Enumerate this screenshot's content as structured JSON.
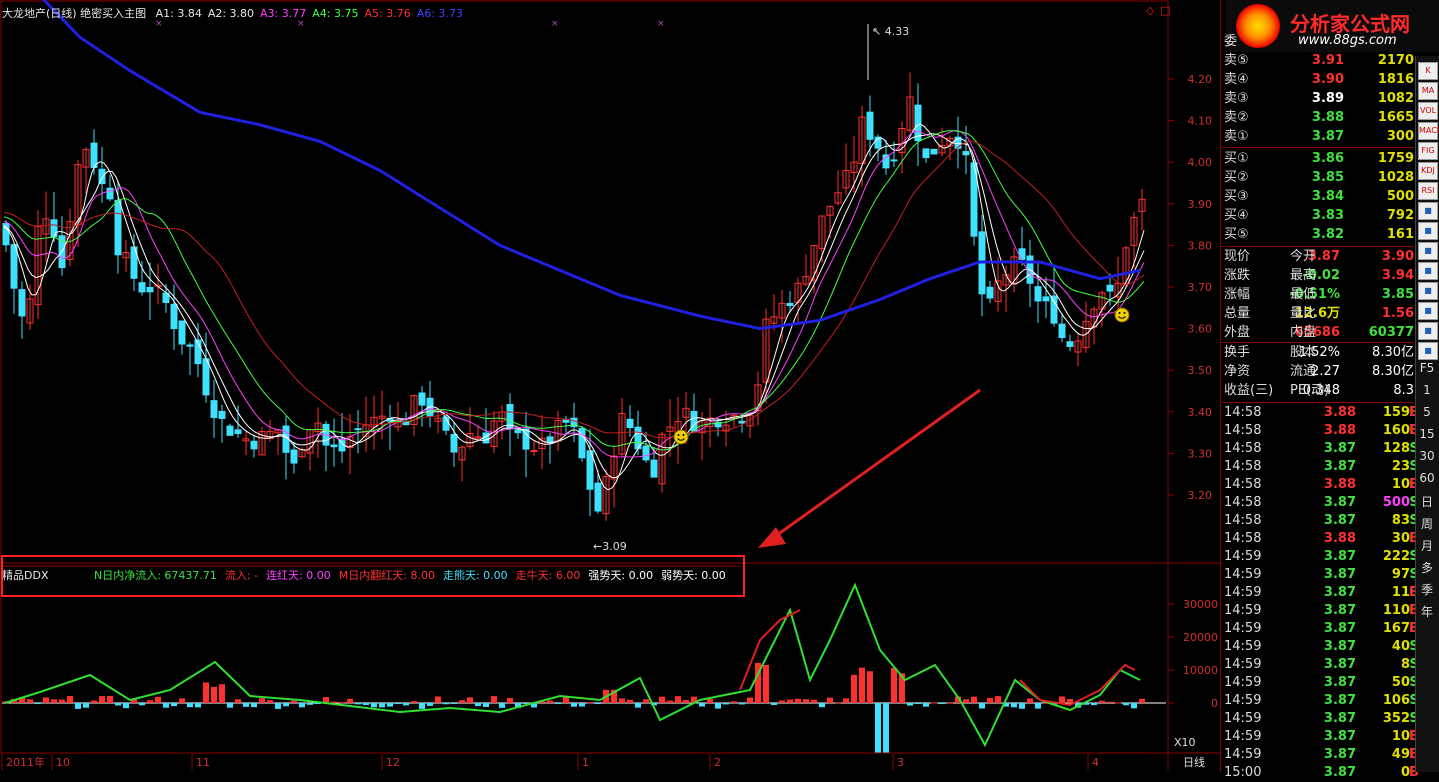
{
  "main_header": {
    "title": "大龙地产(日线) 绝密买入主图",
    "items": [
      {
        "label": "A1: 3.84",
        "color": "#e6e6e6"
      },
      {
        "label": "A2: 3.80",
        "color": "#e6e6e6"
      },
      {
        "label": "A3: 3.77",
        "color": "#ff40ff"
      },
      {
        "label": "A4: 3.75",
        "color": "#40ff40"
      },
      {
        "label": "A5: 3.76",
        "color": "#ff3030"
      },
      {
        "label": "A6: 3.73",
        "color": "#4040ff"
      }
    ]
  },
  "price_axis": [
    "4.20",
    "4.10",
    "4.00",
    "3.90",
    "3.80",
    "3.70",
    "3.60",
    "3.50",
    "3.40",
    "3.30",
    "3.20"
  ],
  "annotations": {
    "high": "4.33",
    "low": "3.09"
  },
  "indicator": {
    "name": "精品DDX",
    "items": [
      {
        "label": "N日内净流入: 67437.71",
        "color": "#40e040"
      },
      {
        "label": "流入: -",
        "color": "#ff3030"
      },
      {
        "label": "连红天: 0.00",
        "color": "#ff40ff"
      },
      {
        "label": "M日内翻红天: 8.00",
        "color": "#ff3030"
      },
      {
        "label": "走熊天: 0.00",
        "color": "#40e0ff"
      },
      {
        "label": "走牛天: 6.00",
        "color": "#ff3030"
      },
      {
        "label": "强势天: 0.00",
        "color": "#ffffff"
      },
      {
        "label": "弱势天: 0.00",
        "color": "#ffffff"
      }
    ],
    "axis": [
      "30000",
      "20000",
      "10000",
      "0"
    ],
    "scale_label": "X10"
  },
  "date_axis": [
    "2011年",
    "10",
    "11",
    "12",
    "1",
    "2",
    "3",
    "4"
  ],
  "period_label": "日线",
  "logo": {
    "title": "分析家公式网",
    "url": "www.88gs.com"
  },
  "quote": {
    "header": "委",
    "sell": [
      {
        "label": "卖⑤",
        "price": "3.91",
        "vol": "2170"
      },
      {
        "label": "卖④",
        "price": "3.90",
        "vol": "1816"
      },
      {
        "label": "卖③",
        "price": "3.89",
        "vol": "1082"
      },
      {
        "label": "卖②",
        "price": "3.88",
        "vol": "1665"
      },
      {
        "label": "卖①",
        "price": "3.87",
        "vol": "300"
      }
    ],
    "buy": [
      {
        "label": "买①",
        "price": "3.86",
        "vol": "1759"
      },
      {
        "label": "买②",
        "price": "3.85",
        "vol": "1028"
      },
      {
        "label": "买③",
        "price": "3.84",
        "vol": "500"
      },
      {
        "label": "买④",
        "price": "3.83",
        "vol": "792"
      },
      {
        "label": "买⑤",
        "price": "3.82",
        "vol": "161"
      }
    ],
    "stats": [
      {
        "l1": "现价",
        "v1": "3.87",
        "c1": "#ff3030",
        "l2": "今开",
        "v2": "3.90",
        "c2": "#ff3030"
      },
      {
        "l1": "涨跌",
        "v1": "-0.02",
        "c1": "#40e040",
        "l2": "最高",
        "v2": "3.94",
        "c2": "#ff3030"
      },
      {
        "l1": "涨幅",
        "v1": "-0.51%",
        "c1": "#40e040",
        "l2": "最低",
        "v2": "3.85",
        "c2": "#40e040"
      },
      {
        "l1": "总量",
        "v1": "12.6万",
        "c1": "#e0e000",
        "l2": "量比",
        "v2": "1.56",
        "c2": "#ff3030"
      },
      {
        "l1": "外盘",
        "v1": "65686",
        "c1": "#ff3030",
        "l2": "内盘",
        "v2": "60377",
        "c2": "#40e040"
      }
    ],
    "stats2": [
      {
        "l1": "换手",
        "v1": "1.52%",
        "l2": "股本",
        "v2": "8.30亿"
      },
      {
        "l1": "净资",
        "v1": "2.27",
        "l2": "流通",
        "v2": "8.30亿"
      },
      {
        "l1": "收益(三)",
        "v1": "0.348",
        "l2": "PE(动)",
        "v2": "8.3"
      }
    ]
  },
  "ticks": [
    {
      "time": "14:58",
      "price": "3.88",
      "vol": "159",
      "dir": "B",
      "vcolor": "#e0e000"
    },
    {
      "time": "14:58",
      "price": "3.88",
      "vol": "160",
      "dir": "B",
      "vcolor": "#e0e000"
    },
    {
      "time": "14:58",
      "price": "3.87",
      "vol": "128",
      "dir": "S",
      "vcolor": "#e0e000"
    },
    {
      "time": "14:58",
      "price": "3.87",
      "vol": "23",
      "dir": "S",
      "vcolor": "#e0e000"
    },
    {
      "time": "14:58",
      "price": "3.88",
      "vol": "10",
      "dir": "B",
      "vcolor": "#e0e000"
    },
    {
      "time": "14:58",
      "price": "3.87",
      "vol": "500",
      "dir": "S",
      "vcolor": "#ff40ff"
    },
    {
      "time": "14:58",
      "price": "3.87",
      "vol": "83",
      "dir": "S",
      "vcolor": "#e0e000"
    },
    {
      "time": "14:58",
      "price": "3.88",
      "vol": "30",
      "dir": "B",
      "vcolor": "#e0e000"
    },
    {
      "time": "14:59",
      "price": "3.87",
      "vol": "222",
      "dir": "S",
      "vcolor": "#e0e000"
    },
    {
      "time": "14:59",
      "price": "3.87",
      "vol": "97",
      "dir": "S",
      "vcolor": "#e0e000"
    },
    {
      "time": "14:59",
      "price": "3.87",
      "vol": "11",
      "dir": "B",
      "vcolor": "#e0e000"
    },
    {
      "time": "14:59",
      "price": "3.87",
      "vol": "110",
      "dir": "B",
      "vcolor": "#e0e000"
    },
    {
      "time": "14:59",
      "price": "3.87",
      "vol": "167",
      "dir": "B",
      "vcolor": "#e0e000"
    },
    {
      "time": "14:59",
      "price": "3.87",
      "vol": "40",
      "dir": "S",
      "vcolor": "#e0e000"
    },
    {
      "time": "14:59",
      "price": "3.87",
      "vol": "8",
      "dir": "S",
      "vcolor": "#e0e000"
    },
    {
      "time": "14:59",
      "price": "3.87",
      "vol": "50",
      "dir": "S",
      "vcolor": "#e0e000"
    },
    {
      "time": "14:59",
      "price": "3.87",
      "vol": "106",
      "dir": "S",
      "vcolor": "#e0e000"
    },
    {
      "time": "14:59",
      "price": "3.87",
      "vol": "352",
      "dir": "S",
      "vcolor": "#e0e000"
    },
    {
      "time": "14:59",
      "price": "3.87",
      "vol": "10",
      "dir": "B",
      "vcolor": "#e0e000"
    },
    {
      "time": "14:59",
      "price": "3.87",
      "vol": "49",
      "dir": "B",
      "vcolor": "#e0e000"
    },
    {
      "time": "15:00",
      "price": "3.87",
      "vol": "0",
      "dir": "B",
      "vcolor": "#e0e000"
    }
  ],
  "toolbar_text": [
    "F5",
    "1",
    "5",
    "15",
    "30",
    "60",
    "日",
    "周",
    "月",
    "多",
    "季",
    "年"
  ],
  "toolbar_icon_labels": [
    "K",
    "MA",
    "VOL",
    "MACD",
    "FIG",
    "KDJ",
    "RSI"
  ],
  "colors": {
    "up": "#ff3030",
    "down": "#40e0ff",
    "border": "#8a0000",
    "highlight_box": "#ff2020"
  }
}
